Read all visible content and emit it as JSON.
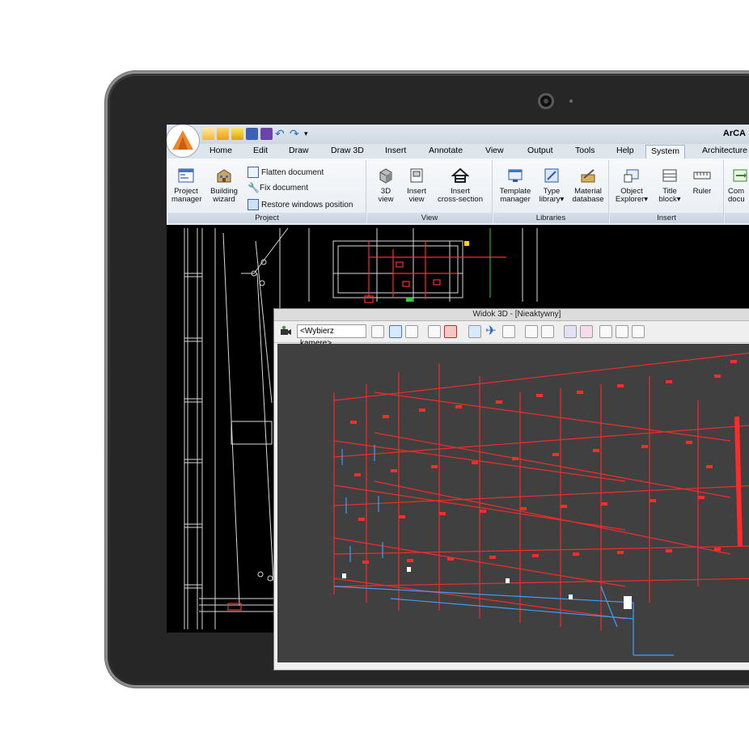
{
  "app": {
    "title": "ArCA"
  },
  "tabs": [
    {
      "label": "Home"
    },
    {
      "label": "Edit"
    },
    {
      "label": "Draw"
    },
    {
      "label": "Draw 3D"
    },
    {
      "label": "Insert"
    },
    {
      "label": "Annotate"
    },
    {
      "label": "View"
    },
    {
      "label": "Output"
    },
    {
      "label": "Tools"
    },
    {
      "label": "Help"
    },
    {
      "label": "System"
    },
    {
      "label": "Architecture"
    }
  ],
  "ribbon": {
    "project": {
      "label": "Project",
      "project_manager": [
        "Project",
        "manager"
      ],
      "building_wizard": [
        "Building",
        "wizard"
      ],
      "flatten": "Flatten document",
      "fix": "Fix document",
      "restore": "Restore windows position"
    },
    "view": {
      "label": "View",
      "view3d": [
        "3D",
        "view"
      ],
      "insert_view": [
        "Insert",
        "view"
      ],
      "insert_cross": [
        "Insert",
        "cross-section"
      ]
    },
    "libraries": {
      "label": "Libraries",
      "template_manager": [
        "Template",
        "manager"
      ],
      "type_library": [
        "Type",
        "library▾"
      ],
      "material_db": [
        "Material",
        "database"
      ]
    },
    "insert": {
      "label": "Insert",
      "object_explorer": [
        "Object",
        "Explorer▾"
      ],
      "title_block": [
        "Title",
        "block▾"
      ],
      "ruler": [
        "Ruler",
        ""
      ]
    },
    "partial": {
      "label": "",
      "compare": [
        "Com",
        "docu"
      ]
    }
  },
  "viewer3d": {
    "title": "Widok 3D - [Nieaktywny]",
    "camera_placeholder": "<Wybierz kamerę>"
  },
  "colors": {
    "accent_orange": "#f0842a",
    "pipe_red": "#ff2a2a",
    "pipe_blue": "#3aa0ff",
    "viewport_bg": "#404040",
    "cad_bg": "#000000"
  }
}
